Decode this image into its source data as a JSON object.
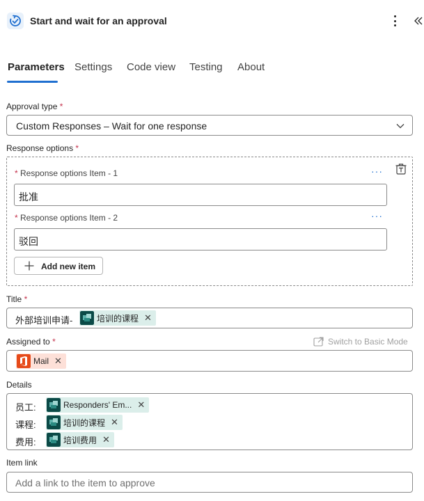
{
  "header": {
    "title": "Start and wait for an approval",
    "icon": "approval-sync-icon"
  },
  "tabs": [
    {
      "label": "Parameters",
      "active": true
    },
    {
      "label": "Settings",
      "active": false
    },
    {
      "label": "Code view",
      "active": false
    },
    {
      "label": "Testing",
      "active": false
    },
    {
      "label": "About",
      "active": false
    }
  ],
  "approval_type": {
    "label": "Approval type",
    "required_mark": "*",
    "value": "Custom Responses – Wait for one response"
  },
  "response_options": {
    "label": "Response options",
    "required_mark": "*",
    "items": [
      {
        "label": "Response options Item - 1",
        "required_mark": "*",
        "value": "批准"
      },
      {
        "label": "Response options Item - 2",
        "required_mark": "*",
        "value": "驳回"
      }
    ],
    "add_label": "Add new item"
  },
  "title_field": {
    "label": "Title",
    "required_mark": "*",
    "prefix": "外部培训申请-",
    "token": "培训的课程"
  },
  "assigned_to": {
    "label": "Assigned to",
    "required_mark": "*",
    "switch_label": "Switch to Basic Mode",
    "token": "Mail"
  },
  "details": {
    "label": "Details",
    "lines": [
      {
        "prefix": "员工:",
        "token": "Responders' Em..."
      },
      {
        "prefix": "课程:",
        "token": "培训的课程"
      },
      {
        "prefix": "费用:",
        "token": "培训费用"
      }
    ]
  },
  "item_link": {
    "label": "Item link",
    "placeholder": "Add a link to the item to approve"
  },
  "colors": {
    "accent": "#1f6fd0",
    "required": "#c4314b",
    "token_green_bg": "#dbeeea",
    "token_orange_bg": "#fde0d8",
    "token_icon_dark": "#0b4a47",
    "office_orange": "#e64a19"
  }
}
